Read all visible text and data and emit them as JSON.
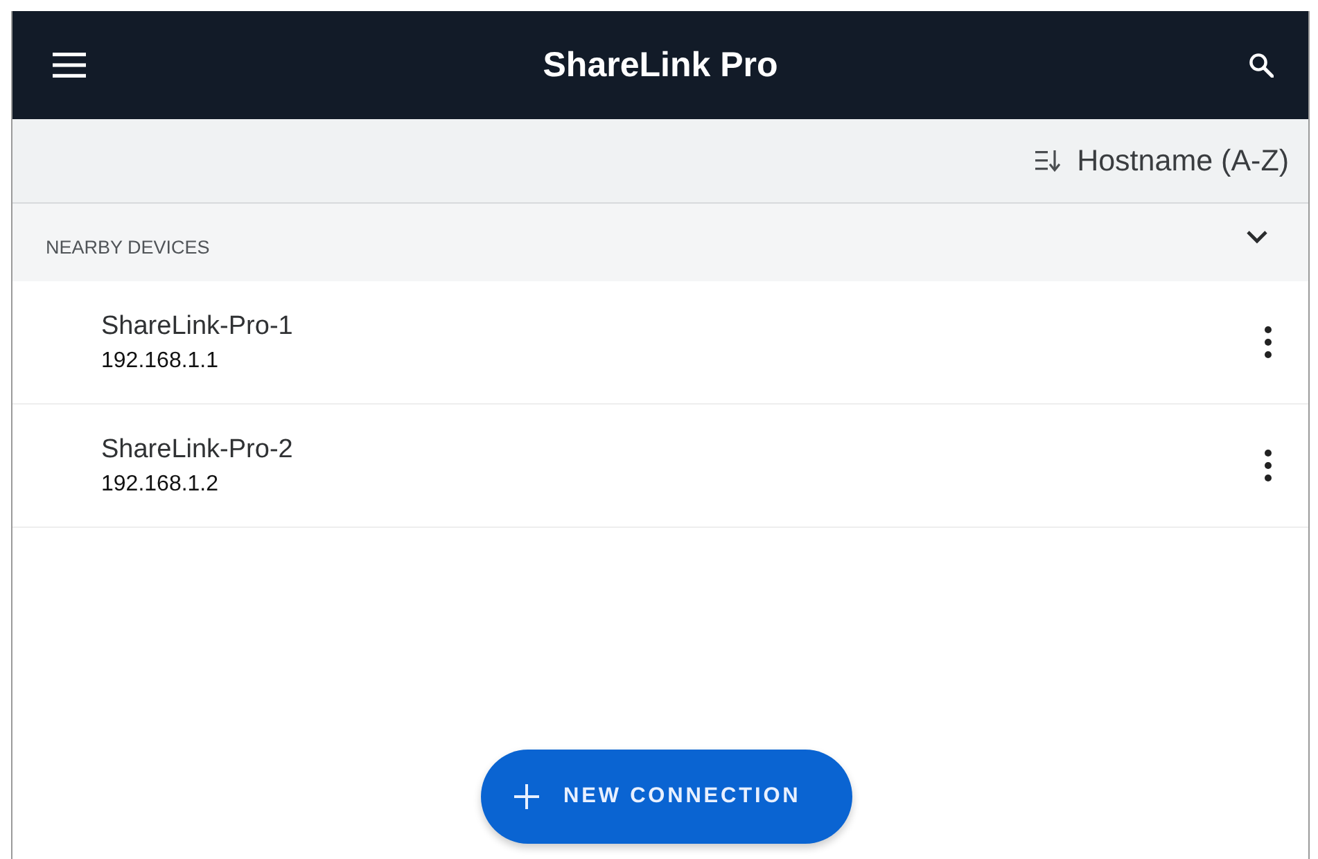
{
  "app_bar": {
    "title": "ShareLink Pro"
  },
  "sort": {
    "label": "Hostname (A-Z)"
  },
  "section": {
    "title": "NEARBY DEVICES",
    "expanded": true
  },
  "devices": [
    {
      "name": "ShareLink-Pro-1",
      "address": "192.168.1.1"
    },
    {
      "name": "ShareLink-Pro-2",
      "address": "192.168.1.2"
    }
  ],
  "fab": {
    "label": "NEW CONNECTION"
  }
}
